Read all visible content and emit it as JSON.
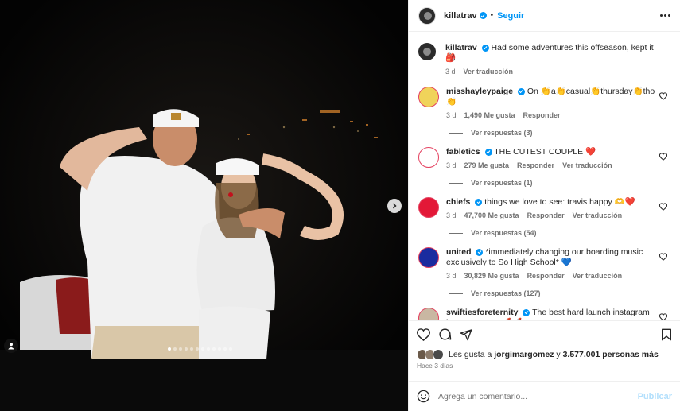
{
  "post": {
    "author": "killatrav",
    "follow_label": "Seguir",
    "bullet": "•",
    "caption": {
      "user": "killatrav",
      "text": "Had some adventures this offseason, kept it 🎒",
      "time": "3 d",
      "translate": "Ver traducción"
    }
  },
  "comments": [
    {
      "user": "misshayleypaige",
      "text": "On 👏a👏casual👏thursday👏tho👏",
      "time": "3 d",
      "likes": "1,490 Me gusta",
      "reply": "Responder",
      "translate": "",
      "replies": "Ver respuestas (3)",
      "avatar_color": "#f0d35a"
    },
    {
      "user": "fabletics",
      "text": "THE CUTEST COUPLE ❤️",
      "time": "3 d",
      "likes": "279 Me gusta",
      "reply": "Responder",
      "translate": "Ver traducción",
      "replies": "Ver respuestas (1)",
      "avatar_color": "#ffffff"
    },
    {
      "user": "chiefs",
      "text": "things we love to see: travis happy 🫶❤️",
      "time": "3 d",
      "likes": "47,700 Me gusta",
      "reply": "Responder",
      "translate": "Ver traducción",
      "replies": "Ver respuestas (54)",
      "avatar_color": "#e31837"
    },
    {
      "user": "united",
      "text": "*immediately changing our boarding music exclusively to So High School* 💙",
      "time": "3 d",
      "likes": "30,829 Me gusta",
      "reply": "Responder",
      "translate": "Ver traducción",
      "replies": "Ver respuestas (127)",
      "avatar_color": "#1a2b9f"
    },
    {
      "user": "swiftiesforeternity",
      "text": "The best hard launch instagram has ever seen 🚀🚀",
      "time": "",
      "likes": "",
      "reply": "",
      "translate": "",
      "replies": "",
      "avatar_color": "#c9b7a2"
    }
  ],
  "likes_line": {
    "prefix": "Les gusta a",
    "user": "jorgimargomez",
    "conj": "y",
    "count": "3.577.001 personas más"
  },
  "posted": "Hace 3 días",
  "add_comment": {
    "placeholder": "Agrega un comentario...",
    "publish": "Publicar"
  },
  "carousel": {
    "slides": 12,
    "active": 0
  },
  "colors": {
    "accent": "#0095f6",
    "publish_disabled": "#b2dffc",
    "muted": "#737373"
  }
}
